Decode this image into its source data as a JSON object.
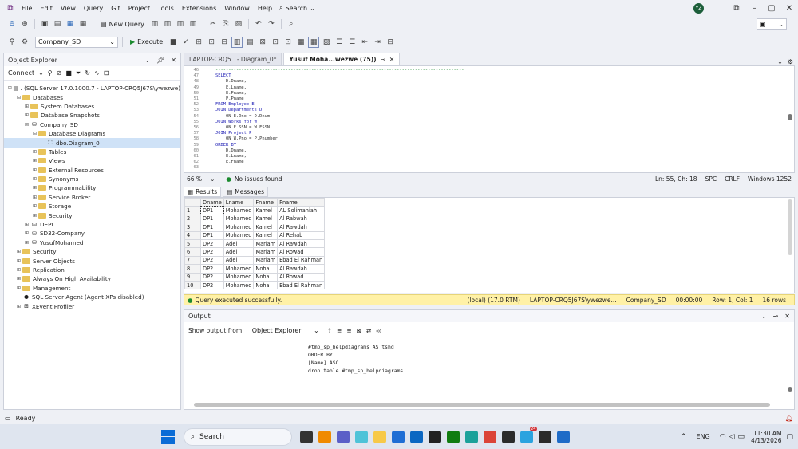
{
  "menubar": {
    "items": [
      "File",
      "Edit",
      "View",
      "Query",
      "Git",
      "Project",
      "Tools",
      "Extensions",
      "Window",
      "Help"
    ],
    "search_label": "Search",
    "user_initials": "YZ"
  },
  "toolbar": {
    "new_query": "New Query",
    "database": "Company_SD",
    "execute": "Execute"
  },
  "object_explorer": {
    "title": "Object Explorer",
    "connect": "Connect",
    "tree": [
      {
        "level": 0,
        "exp": "⊟",
        "icon": "server",
        "label": ". (SQL Server 17.0.1000.7 - LAPTOP-CRQ5J67S\\ywezwe)"
      },
      {
        "level": 1,
        "exp": "⊟",
        "icon": "folder",
        "label": "Databases"
      },
      {
        "level": 2,
        "exp": "⊞",
        "icon": "folder",
        "label": "System Databases"
      },
      {
        "level": 2,
        "exp": "⊞",
        "icon": "folder",
        "label": "Database Snapshots"
      },
      {
        "level": 2,
        "exp": "⊟",
        "icon": "db",
        "label": "Company_SD"
      },
      {
        "level": 3,
        "exp": "⊟",
        "icon": "folder",
        "label": "Database Diagrams"
      },
      {
        "level": 4,
        "exp": "",
        "icon": "diagram",
        "label": "dbo.Diagram_0",
        "selected": true
      },
      {
        "level": 3,
        "exp": "⊞",
        "icon": "folder",
        "label": "Tables"
      },
      {
        "level": 3,
        "exp": "⊞",
        "icon": "folder",
        "label": "Views"
      },
      {
        "level": 3,
        "exp": "⊞",
        "icon": "folder",
        "label": "External Resources"
      },
      {
        "level": 3,
        "exp": "⊞",
        "icon": "folder",
        "label": "Synonyms"
      },
      {
        "level": 3,
        "exp": "⊞",
        "icon": "folder",
        "label": "Programmability"
      },
      {
        "level": 3,
        "exp": "⊞",
        "icon": "folder",
        "label": "Service Broker"
      },
      {
        "level": 3,
        "exp": "⊞",
        "icon": "folder",
        "label": "Storage"
      },
      {
        "level": 3,
        "exp": "⊞",
        "icon": "folder",
        "label": "Security"
      },
      {
        "level": 2,
        "exp": "⊞",
        "icon": "db",
        "label": "DEPI"
      },
      {
        "level": 2,
        "exp": "⊞",
        "icon": "db",
        "label": "SD32-Company"
      },
      {
        "level": 2,
        "exp": "⊞",
        "icon": "db",
        "label": "YusufMohamed"
      },
      {
        "level": 1,
        "exp": "⊞",
        "icon": "folder",
        "label": "Security"
      },
      {
        "level": 1,
        "exp": "⊞",
        "icon": "folder",
        "label": "Server Objects"
      },
      {
        "level": 1,
        "exp": "⊞",
        "icon": "folder",
        "label": "Replication"
      },
      {
        "level": 1,
        "exp": "⊞",
        "icon": "folder",
        "label": "Always On High Availability"
      },
      {
        "level": 1,
        "exp": "⊞",
        "icon": "folder",
        "label": "Management"
      },
      {
        "level": 1,
        "exp": "",
        "icon": "agent",
        "label": "SQL Server Agent (Agent XPs disabled)"
      },
      {
        "level": 1,
        "exp": "⊞",
        "icon": "xevent",
        "label": "XEvent Profiler"
      }
    ]
  },
  "tabs": [
    {
      "label": "LAPTOP-CRQ5...- Diagram_0*",
      "active": false
    },
    {
      "label": "Yusuf Moha...wezwe (75))",
      "active": true
    }
  ],
  "editor": {
    "lines": [
      {
        "n": "46",
        "code": "    ------------------------------------------------------------------------------------------------"
      },
      {
        "n": "47",
        "code": "    SELECT"
      },
      {
        "n": "48",
        "code": "        D.Dname,"
      },
      {
        "n": "49",
        "code": "        E.Lname,"
      },
      {
        "n": "50",
        "code": "        E.Fname,"
      },
      {
        "n": "51",
        "code": "        P.Pname"
      },
      {
        "n": "52",
        "code": "    FROM Employee E"
      },
      {
        "n": "53",
        "code": "    JOIN Departments D"
      },
      {
        "n": "54",
        "code": "        ON E.Dno = D.Dnum"
      },
      {
        "n": "55",
        "code": "    JOIN Works_for W"
      },
      {
        "n": "56",
        "code": "        ON E.SSN = W.ESSN"
      },
      {
        "n": "57",
        "code": "    JOIN Project P"
      },
      {
        "n": "58",
        "code": "        ON W.Pno = P.Pnumber"
      },
      {
        "n": "59",
        "code": "    ORDER BY"
      },
      {
        "n": "60",
        "code": "        D.Dname,"
      },
      {
        "n": "61",
        "code": "        E.Lname,"
      },
      {
        "n": "62",
        "code": "        E.Fname"
      },
      {
        "n": "63",
        "code": "    ------------------------------------------------------------------------------------------------"
      }
    ]
  },
  "editor_status": {
    "zoom": "66 %",
    "issues": "No issues found",
    "position": "Ln: 55, Ch: 18",
    "spc": "SPC",
    "crlf": "CRLF",
    "encoding": "Windows 1252"
  },
  "results_tabs": {
    "results": "Results",
    "messages": "Messages"
  },
  "grid": {
    "columns": [
      "Dname",
      "Lname",
      "Fname",
      "Pname"
    ],
    "rows": [
      [
        "1",
        "DP1",
        "Mohamed",
        "Kamel",
        "AL Solimaniah"
      ],
      [
        "2",
        "DP1",
        "Mohamed",
        "Kamel",
        "Al Rabwah"
      ],
      [
        "3",
        "DP1",
        "Mohamed",
        "Kamel",
        "Al Rawdah"
      ],
      [
        "4",
        "DP1",
        "Mohamed",
        "Kamel",
        "Al Rehab"
      ],
      [
        "5",
        "DP2",
        "Adel",
        "Mariam",
        "Al Rawdah"
      ],
      [
        "6",
        "DP2",
        "Adel",
        "Mariam",
        "Al Rowad"
      ],
      [
        "7",
        "DP2",
        "Adel",
        "Mariam",
        "Ebad El Rahman"
      ],
      [
        "8",
        "DP2",
        "Mohamed",
        "Noha",
        "Al Rawdah"
      ],
      [
        "9",
        "DP2",
        "Mohamed",
        "Noha",
        "Al Rowad"
      ],
      [
        "10",
        "DP2",
        "Mohamed",
        "Noha",
        "Ebad El Rahman"
      ]
    ]
  },
  "query_status": {
    "message": "Query executed successfully.",
    "server": "(local) (17.0 RTM)",
    "login": "LAPTOP-CRQ5J67S\\ywezwe...",
    "database": "Company_SD",
    "time": "00:00:00",
    "rowcol": "Row: 1, Col: 1",
    "rows": "16 rows"
  },
  "output": {
    "title": "Output",
    "show_from": "Show output from:",
    "source": "Object Explorer",
    "lines": [
      "#tmp_sp_helpdiagrams AS tshd",
      "ORDER BY",
      "[Name] ASC",
      "drop table #tmp_sp_helpdiagrams"
    ]
  },
  "statusbar": {
    "text": "Ready"
  },
  "taskbar": {
    "search": "Search",
    "lang": "ENG",
    "time": "11:30 AM",
    "date": "4/13/2026",
    "badge": "24"
  },
  "colors": {
    "accent": "#68217a",
    "query_ok": "#fff1a6",
    "selection": "#cfe2f7"
  }
}
